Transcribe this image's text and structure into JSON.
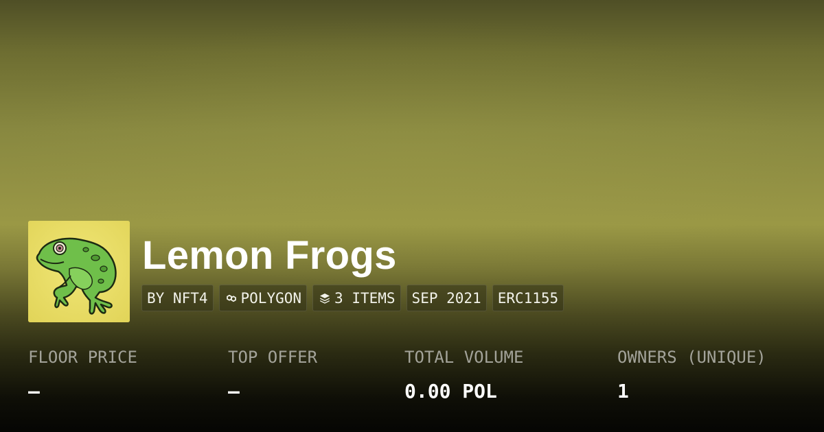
{
  "collection": {
    "name": "Lemon Frogs",
    "tags": [
      {
        "label": "BY NFT4",
        "icon": ""
      },
      {
        "label": "POLYGON",
        "icon": "polygon-chain-icon"
      },
      {
        "label": "3 ITEMS",
        "icon": "layers-icon"
      },
      {
        "label": "SEP 2021",
        "icon": ""
      },
      {
        "label": "ERC1155",
        "icon": ""
      }
    ]
  },
  "stats": [
    {
      "label": "FLOOR PRICE",
      "value": "–"
    },
    {
      "label": "TOP OFFER",
      "value": "–"
    },
    {
      "label": "TOTAL VOLUME",
      "value": "0.00 POL"
    },
    {
      "label": "OWNERS (UNIQUE)",
      "value": "1"
    }
  ],
  "colors": {
    "background_top": "#4f4f26",
    "background_mid": "#9a9845",
    "background_bottom": "#050503",
    "avatar_background": "#e8dc63",
    "frog_green": "#6fbf4a",
    "label_gray": "#a3a39a",
    "text_white": "#ffffff"
  }
}
